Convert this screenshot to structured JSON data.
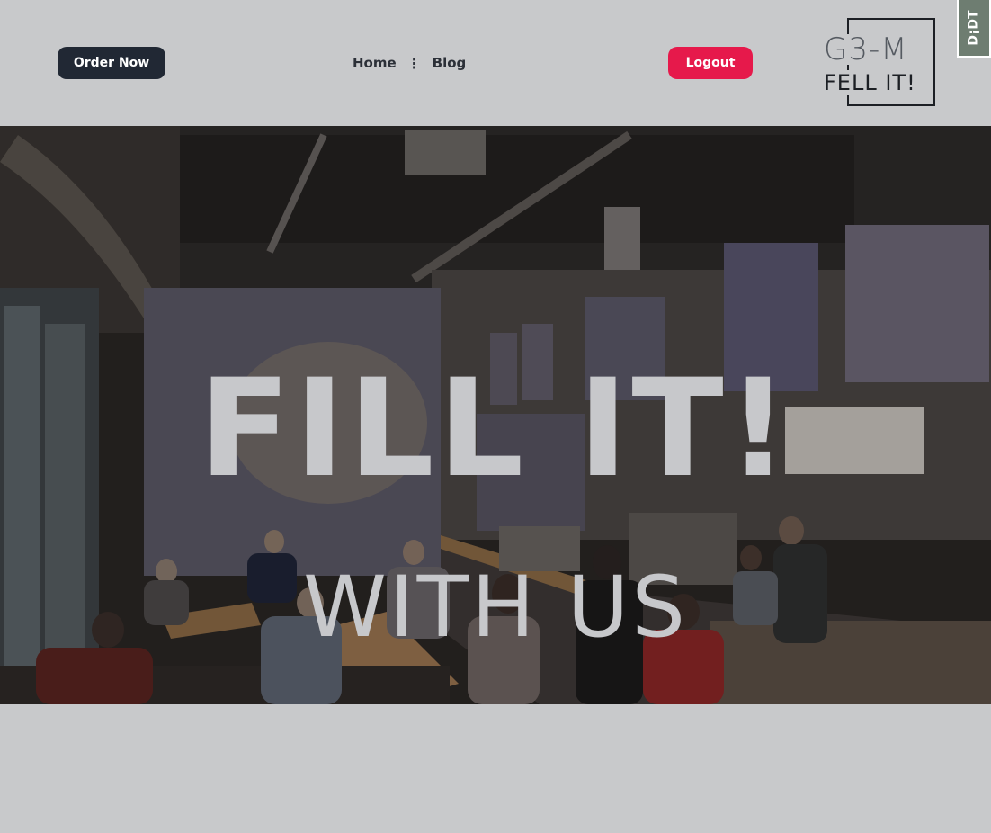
{
  "nav": {
    "order_label": "Order Now",
    "links": [
      {
        "label": "Home"
      },
      {
        "label": "Blog"
      }
    ],
    "separator": "⋮",
    "logout_label": "Logout"
  },
  "logo": {
    "top_text": "G3-M",
    "bottom_text": "FELL IT!"
  },
  "badge": {
    "text": "D¡DT"
  },
  "hero": {
    "title": "FILL IT!",
    "subtitle": "WITH US"
  },
  "colors": {
    "page_bg": "#c8c9cb",
    "order_button": "#212834",
    "logout_button": "#e6194b",
    "hero_text": "#c7c8cb"
  }
}
